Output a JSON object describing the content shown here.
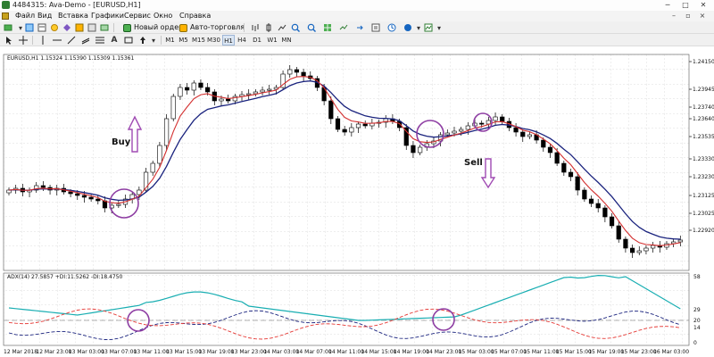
{
  "window": {
    "title": "4484315: Ava-Demo - [EURUSD,H1]"
  },
  "menu": {
    "items": [
      "Файл",
      "Вид",
      "Вставка",
      "Графики",
      "Сервис",
      "Окно",
      "Справка"
    ]
  },
  "toolbar": {
    "new_order_label": "Новый ордер",
    "autotrading_label": "Авто-торговля",
    "timeframes": [
      "M1",
      "M5",
      "M15",
      "M30",
      "H1",
      "H4",
      "D1",
      "W1",
      "MN"
    ]
  },
  "chart": {
    "header": "EURUSD,H1  1.15324 1.15390 1.15309 1.15361",
    "price_ticks": [
      "1.24150",
      "1.23945",
      "1.23740",
      "1.23640",
      "1.23535",
      "1.23330",
      "1.23230",
      "1.23125",
      "1.23025",
      "1.22920"
    ],
    "time_ticks": [
      "12 Mar 2018",
      "12 Mar 23:00",
      "13 Mar 03:00",
      "13 Mar 07:00",
      "13 Mar 11:00",
      "13 Mar 15:00",
      "13 Mar 19:00",
      "13 Mar 23:00",
      "14 Mar 03:00",
      "14 Mar 07:00",
      "14 Mar 11:00",
      "14 Mar 15:00",
      "14 Mar 19:00",
      "14 Mar 23:00",
      "15 Mar 03:00",
      "15 Mar 07:00",
      "15 Mar 11:00",
      "15 Mar 15:00",
      "15 Mar 19:00",
      "15 Mar 23:00",
      "16 Mar 03:00"
    ],
    "annotations": {
      "buy": "Buy",
      "sell": "Sell"
    },
    "colors": {
      "up": "#ffffff",
      "down": "#000000",
      "ma_fast": "#d32f2f",
      "ma_slow": "#1a237e",
      "circle": "#8e3ea3",
      "arrow": "#a04bb3"
    }
  },
  "indicator": {
    "header": "ADX(14) 27.5857 +DI:11.5262 -DI:18.4750",
    "scale_ticks": [
      "58",
      "29",
      "20",
      "14",
      "0"
    ],
    "colors": {
      "adx": "#19aeb2",
      "plus_di": "#1a237e",
      "minus_di": "#e53935"
    }
  }
}
